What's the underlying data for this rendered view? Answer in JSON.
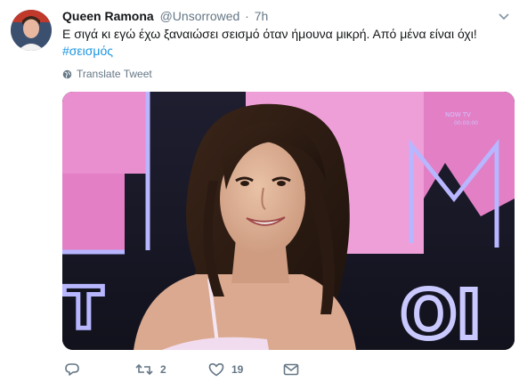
{
  "tweet": {
    "author_name": "Queen Ramona",
    "author_handle": "@Unsorrowed",
    "separator": "·",
    "time": "7h",
    "text": "Ε σιγά κι εγώ έχω ξαναιώσει σεισμό όταν ήμουνα μικρή. Από μένα είναι όχι!",
    "hashtag": "#σεισμός",
    "translate_label": "Translate Tweet"
  },
  "media": {
    "watermark_line1": "NOW TV",
    "watermark_line2": "00:00:00"
  },
  "actions": {
    "reply_count": "",
    "retweet_count": "2",
    "like_count": "19"
  },
  "colors": {
    "accent": "#1b95e0",
    "muted": "#657786",
    "text": "#14171a",
    "stage_pink": "#e98fcf"
  },
  "icons": {
    "caret": "chevron-down-icon",
    "translate": "globe-icon",
    "reply": "reply-icon",
    "retweet": "retweet-icon",
    "like": "heart-icon",
    "dm": "envelope-icon"
  }
}
